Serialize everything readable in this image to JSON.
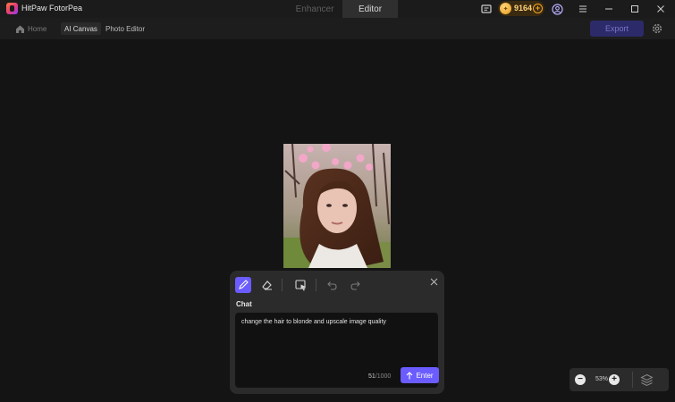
{
  "app": {
    "title": "HitPaw FotorPea"
  },
  "mode_tabs": [
    {
      "label": "Enhancer",
      "active": false
    },
    {
      "label": "Editor",
      "active": true
    }
  ],
  "titlebar": {
    "credits": "9164",
    "icons": [
      "notes-icon",
      "coin-icon",
      "add-credits-icon",
      "account-icon",
      "menu-icon",
      "minimize-icon",
      "maximize-icon",
      "close-icon"
    ]
  },
  "toolbar": {
    "home_label": "Home",
    "nav_items": [
      {
        "label": "AI Canvas",
        "active": true
      },
      {
        "label": "Photo Editor",
        "active": false
      }
    ],
    "export_label": "Export"
  },
  "chat": {
    "label": "Chat",
    "text": "change the hair to blonde and upscale image quality",
    "count_current": "51",
    "count_max": "/1000",
    "enter_label": "Enter",
    "tools": [
      "brush-icon",
      "eraser-icon",
      "select-icon",
      "undo-icon",
      "redo-icon"
    ]
  },
  "zoom": {
    "value": "53%"
  },
  "colors": {
    "accent": "#6b5cff",
    "gold": "#f4a623",
    "background": "#141414"
  }
}
